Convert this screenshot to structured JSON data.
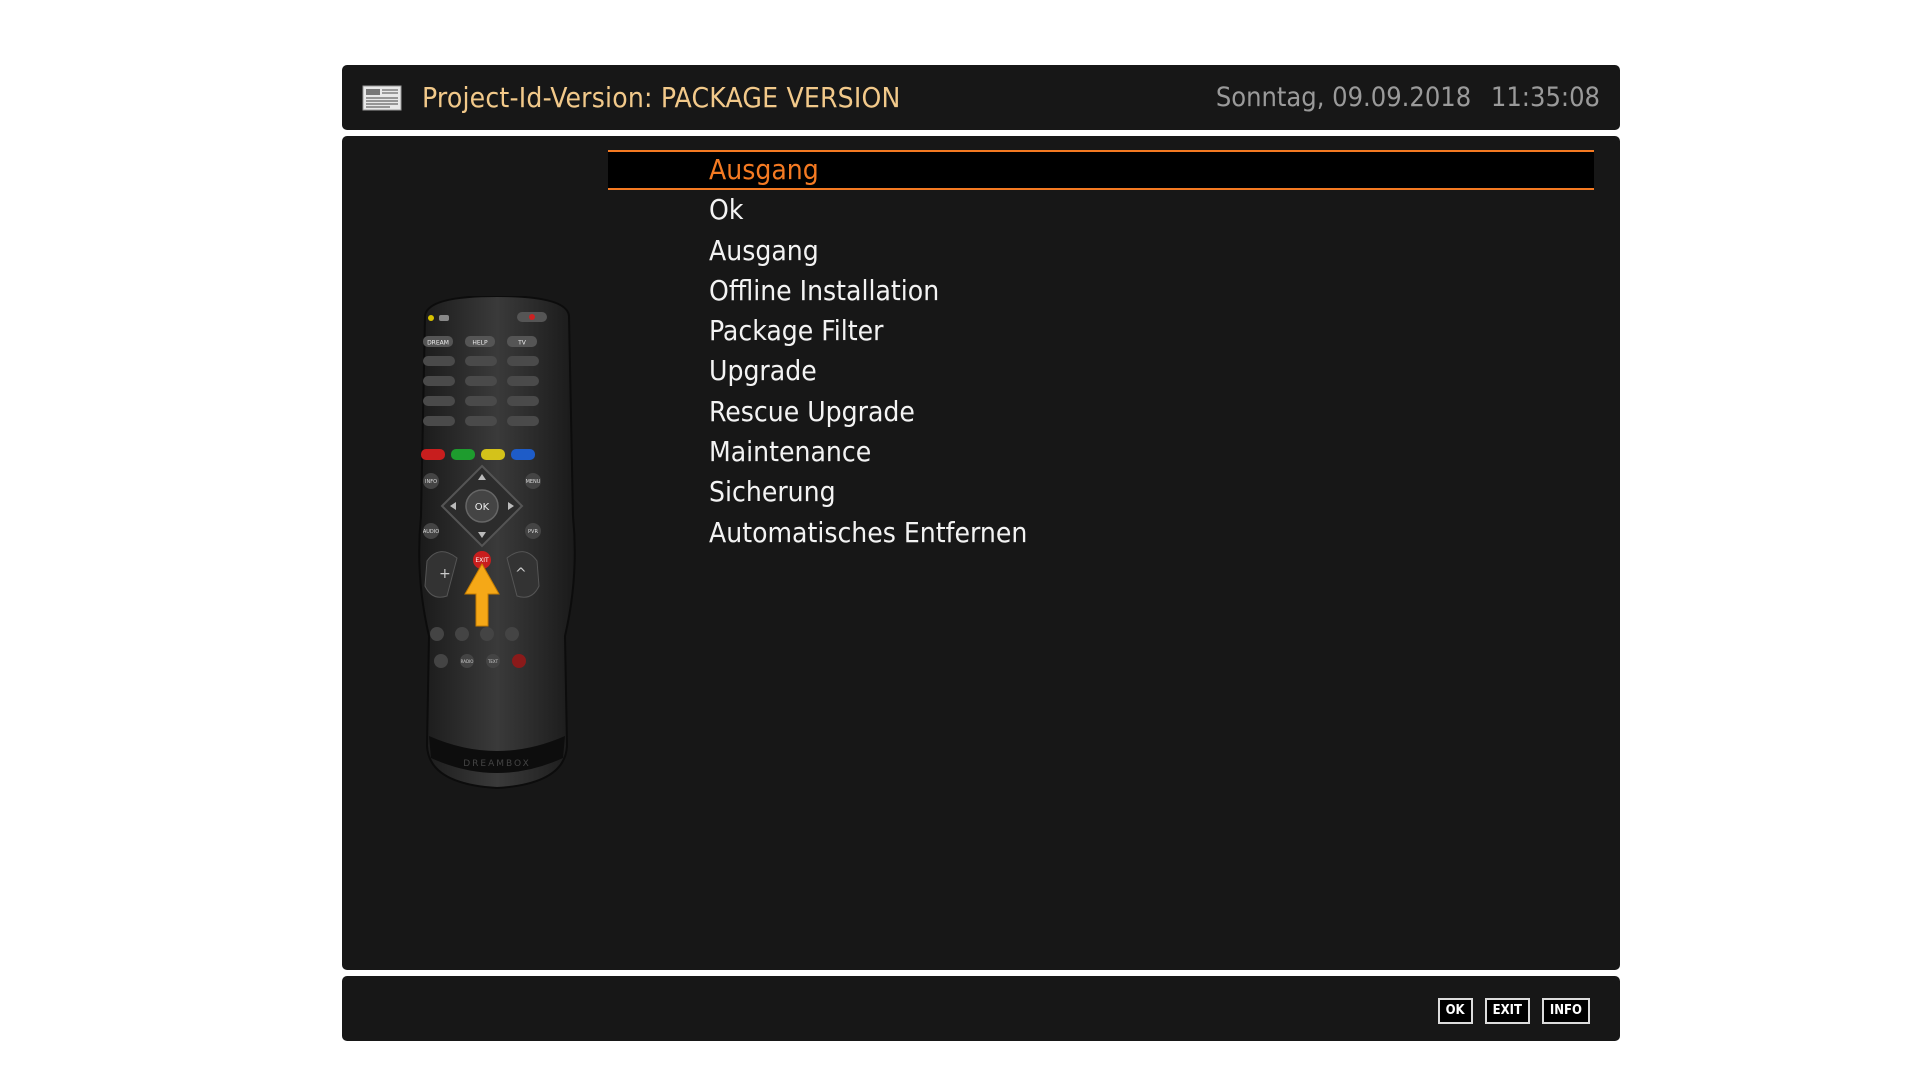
{
  "header": {
    "title": "Project-Id-Version: PACKAGE VERSION",
    "date": "Sonntag, 09.09.2018",
    "time": "11:35:08",
    "icon": "newspaper-icon"
  },
  "remote": {
    "icon": "remote-control-icon",
    "brand": "DREAMBOX",
    "buttons": {
      "dream": "DREAM",
      "help": "HELP",
      "tv": "TV",
      "ok": "OK",
      "info": "INFO",
      "menu": "MENU",
      "audio": "AUDIO",
      "pvr": "PVR",
      "exit": "EXIT",
      "radio": "RADIO",
      "text": "TEXT"
    },
    "highlighted_button": "EXIT"
  },
  "menu": {
    "selected_index": 0,
    "items": [
      "Ausgang",
      "Ok",
      "Ausgang",
      "Offline Installation",
      "Package Filter",
      "Upgrade",
      "Rescue Upgrade",
      "Maintenance",
      "Sicherung",
      "Automatisches Entfernen"
    ]
  },
  "footer": {
    "keys": [
      "OK",
      "EXIT",
      "INFO"
    ]
  },
  "colors": {
    "panel": "#171717",
    "title": "#f2c98a",
    "selected": "#f57a22",
    "text": "#f3f3f3",
    "date": "#9a9a9a"
  }
}
